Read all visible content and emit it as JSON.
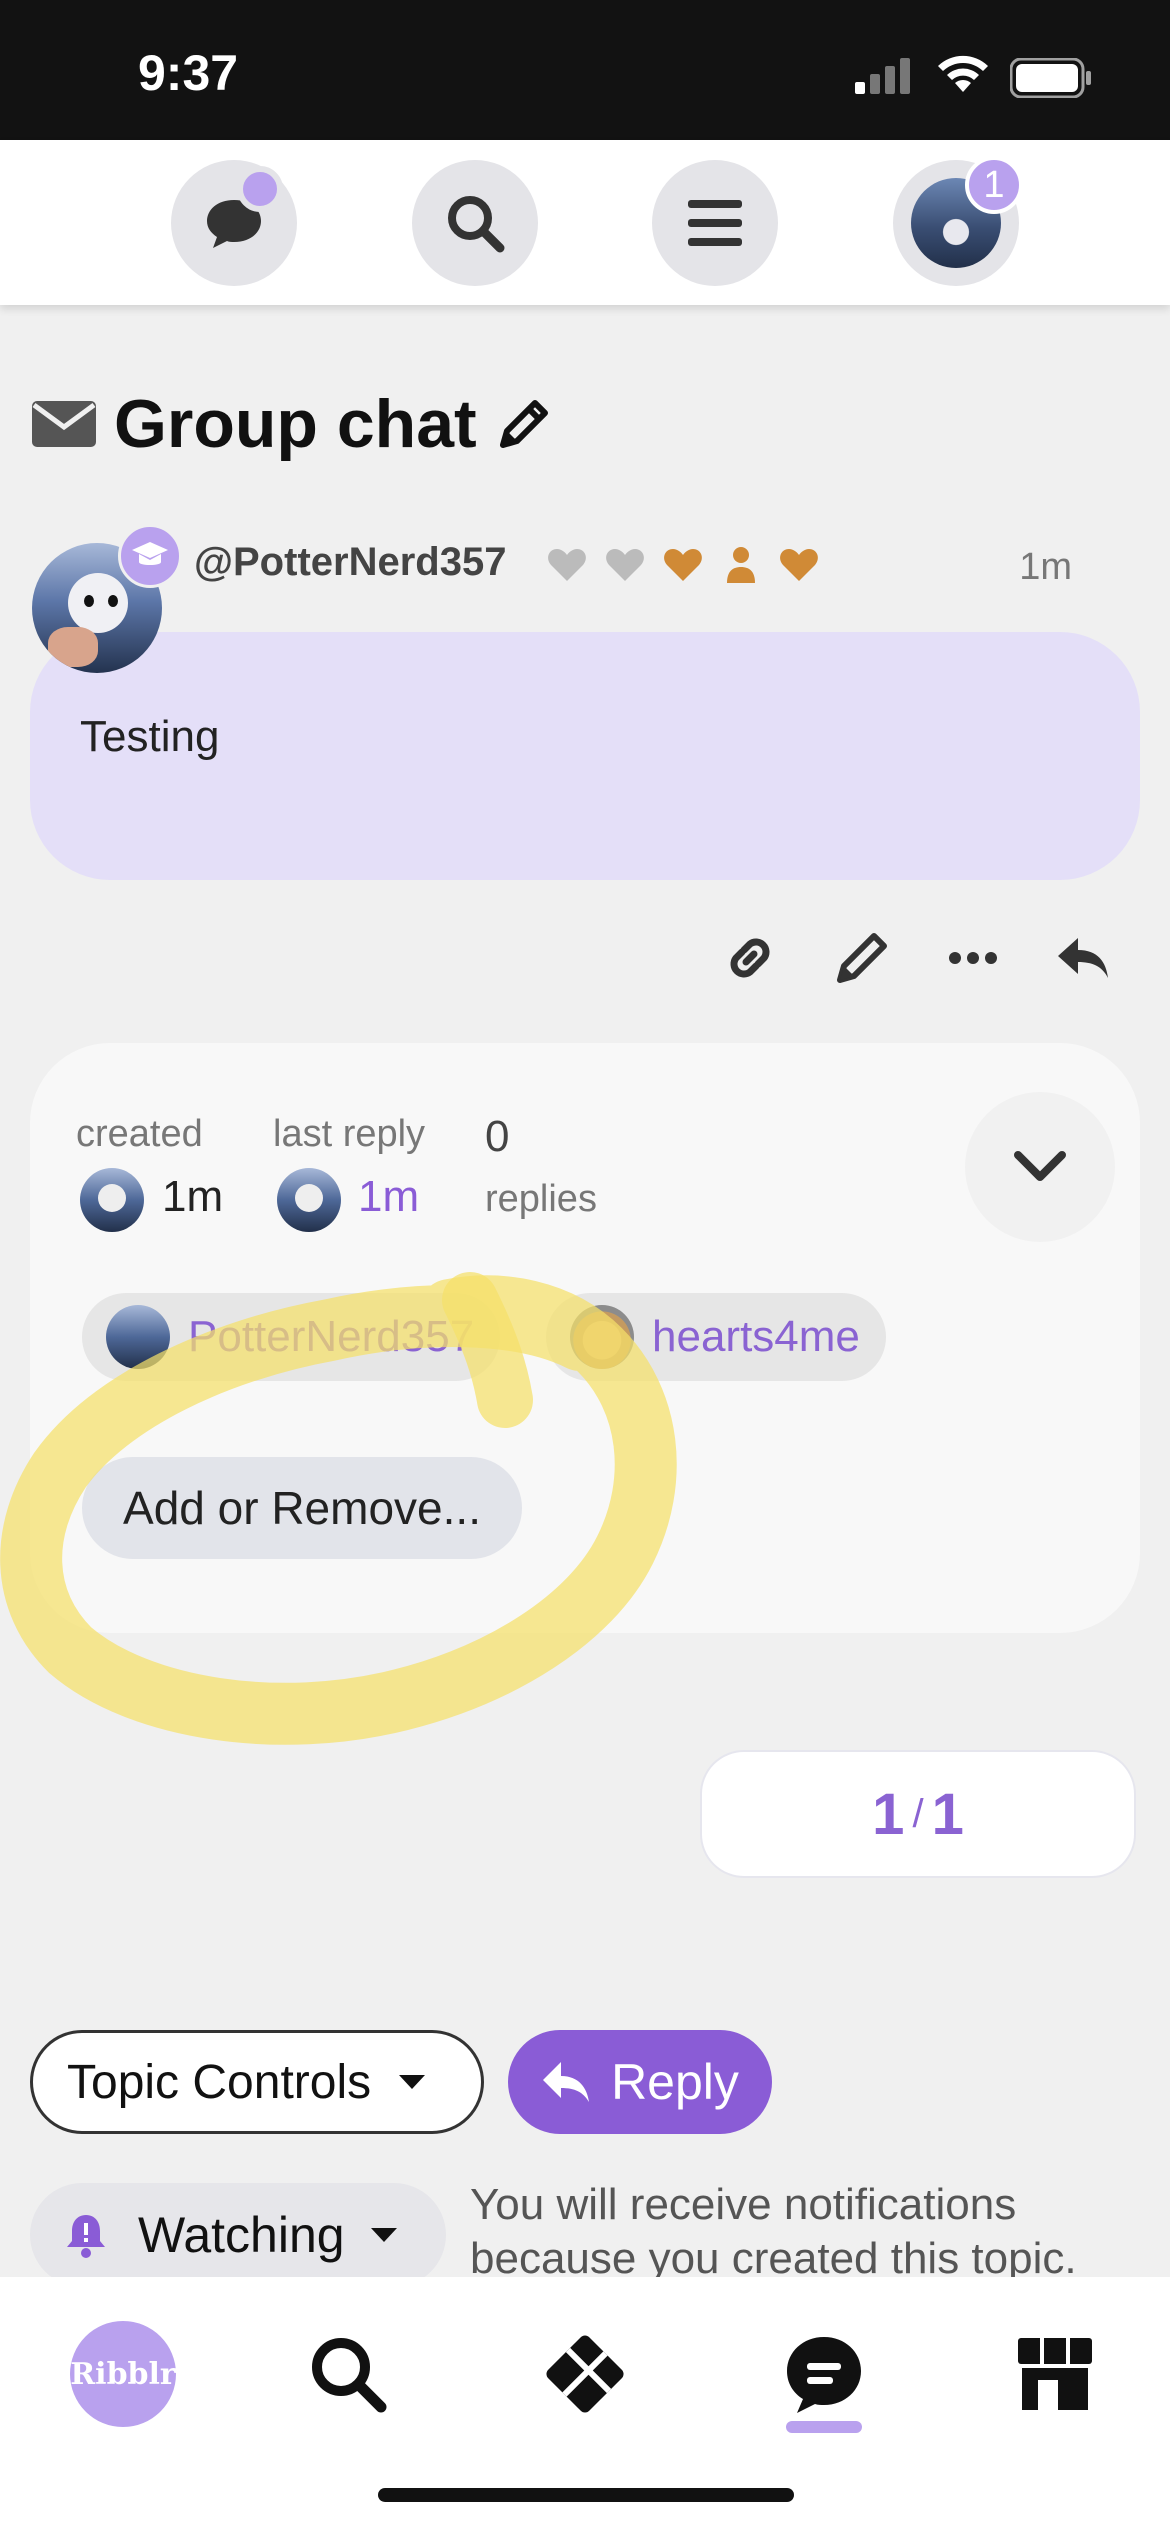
{
  "status_bar": {
    "time": "9:37"
  },
  "header": {
    "chat_icon": "chat-bubble-icon",
    "search_icon": "search-icon",
    "menu_icon": "hamburger-menu-icon",
    "notification_count": "1"
  },
  "topic": {
    "title": "Group chat"
  },
  "post": {
    "username": "@PotterNerd357",
    "time": "1m",
    "text": "Testing"
  },
  "topic_map": {
    "created_label": "created",
    "created_value": "1m",
    "last_reply_label": "last reply",
    "last_reply_value": "1m",
    "replies_count": "0",
    "replies_label": "replies",
    "participants": [
      "PotterNerd357",
      "hearts4me"
    ],
    "add_remove_label": "Add or Remove..."
  },
  "progress": {
    "current": "1",
    "total": "1"
  },
  "footer": {
    "topic_controls_label": "Topic Controls",
    "reply_label": "Reply",
    "watching_label": "Watching",
    "notification_text": "You will receive notifications because you created this topic."
  },
  "bottom_nav": {
    "logo_text": "Ribblr"
  },
  "colors": {
    "accent": "#8a5cd6",
    "accent_light": "#b9a1ee",
    "bubble": "#e4dff8",
    "highlight": "#f5e06a"
  }
}
